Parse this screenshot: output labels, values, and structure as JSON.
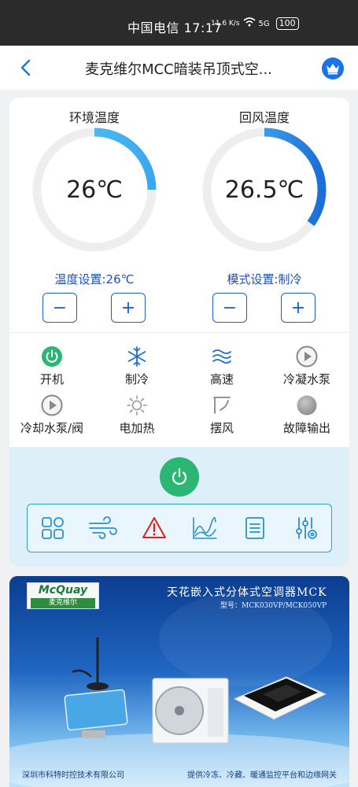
{
  "status_bar": {
    "carrier_time": "中国电信 17:17",
    "speed": "11.6 K/s",
    "network": "5G",
    "battery": "100"
  },
  "header": {
    "title": "麦克维尔MCC暗装吊顶式空..."
  },
  "gauges": [
    {
      "title": "环境温度",
      "value": "26℃",
      "fill_fraction": 0.25
    },
    {
      "title": "回风温度",
      "value": "26.5℃",
      "fill_fraction": 0.35
    }
  ],
  "settings": {
    "temp_label": "温度设置:26℃",
    "mode_label": "模式设置:制冷",
    "minus": "−",
    "plus": "+"
  },
  "status_items": [
    {
      "label": "开机",
      "icon": "power-on-icon"
    },
    {
      "label": "制冷",
      "icon": "snowflake-icon"
    },
    {
      "label": "高速",
      "icon": "wind-waves-icon"
    },
    {
      "label": "冷凝水泵",
      "icon": "play-circle-icon"
    },
    {
      "label": "冷却水泵/阀",
      "icon": "play-circle-icon"
    },
    {
      "label": "电加热",
      "icon": "sun-icon"
    },
    {
      "label": "摆风",
      "icon": "swing-icon"
    },
    {
      "label": "故障输出",
      "icon": "fault-dot-icon"
    }
  ],
  "banner": {
    "brand": "McQuay",
    "brand_cn": "麦克维尔",
    "title": "天花嵌入式分体式空调器MCK",
    "model": "型号：MCK030VP/MCK050VP",
    "company": "深圳市科特时控技术有限公司",
    "slogan": "提供冷冻、冷藏、暖通监控平台和边缘网关"
  },
  "colors": {
    "accent_blue": "#1a5fcf",
    "power_green": "#2bb673",
    "gauge_start": "#1a6fd8",
    "gauge_end": "#5cc9f2",
    "alert_red": "#e02020"
  }
}
